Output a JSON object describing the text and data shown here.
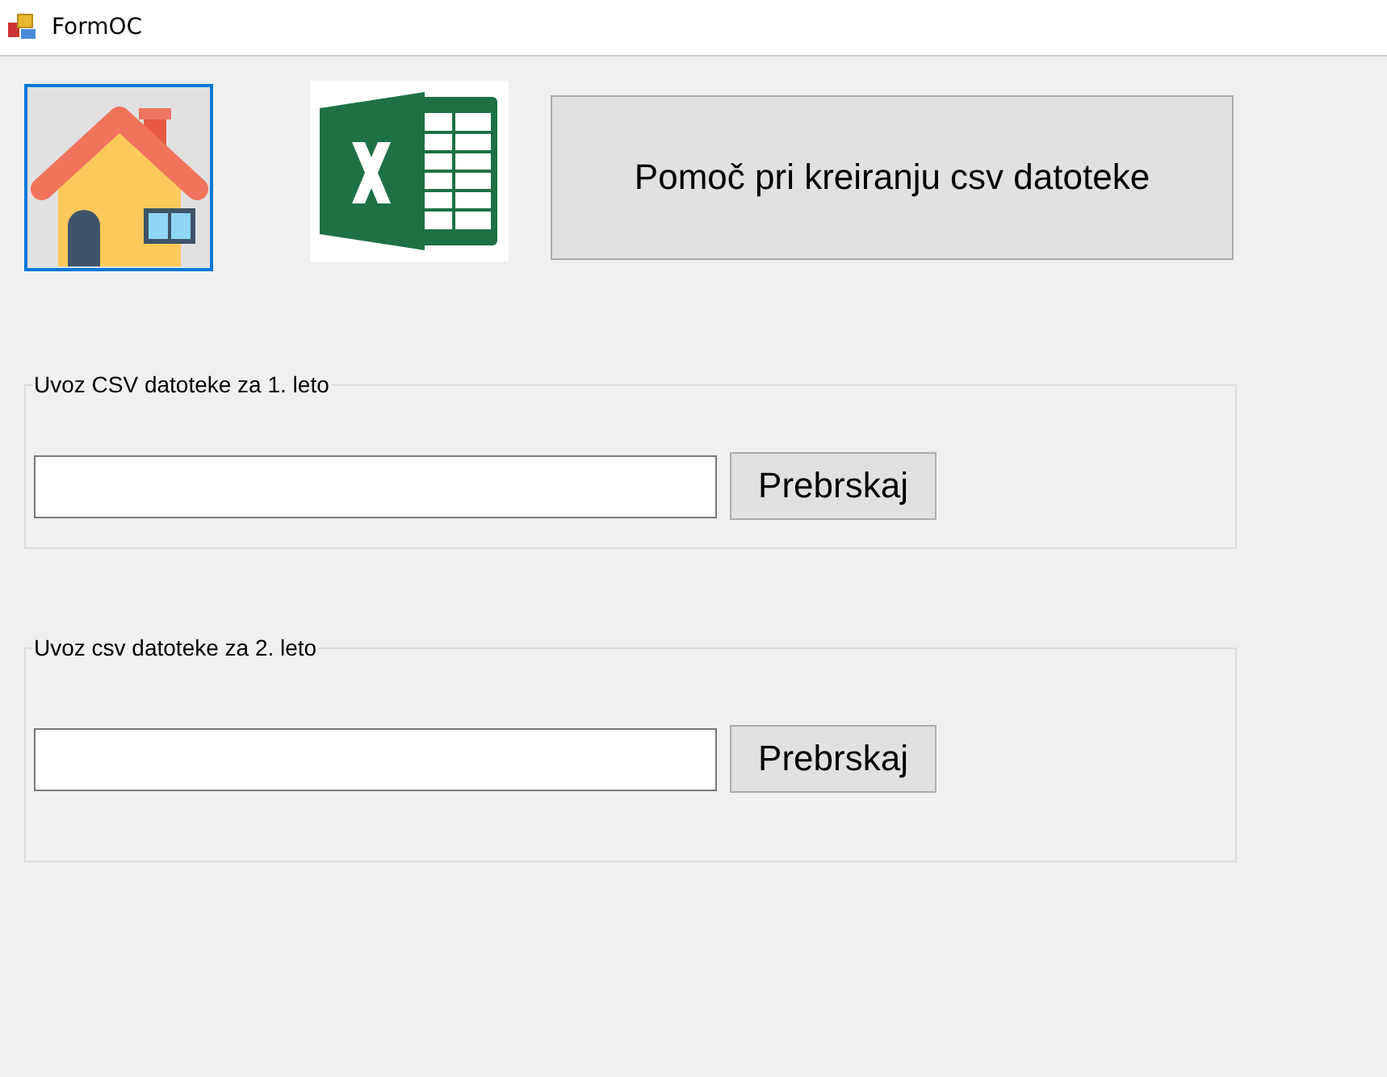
{
  "window": {
    "title": "FormOC"
  },
  "home_button": {
    "focused": true
  },
  "help_button": {
    "label": "Pomoč pri kreiranju csv datoteke"
  },
  "groups": [
    {
      "title": "Uvoz CSV datoteke za 1. leto",
      "button": "Prebrskaj"
    },
    {
      "title": "Uvoz csv datoteke za 2. leto",
      "button": "Prebrskaj"
    }
  ]
}
